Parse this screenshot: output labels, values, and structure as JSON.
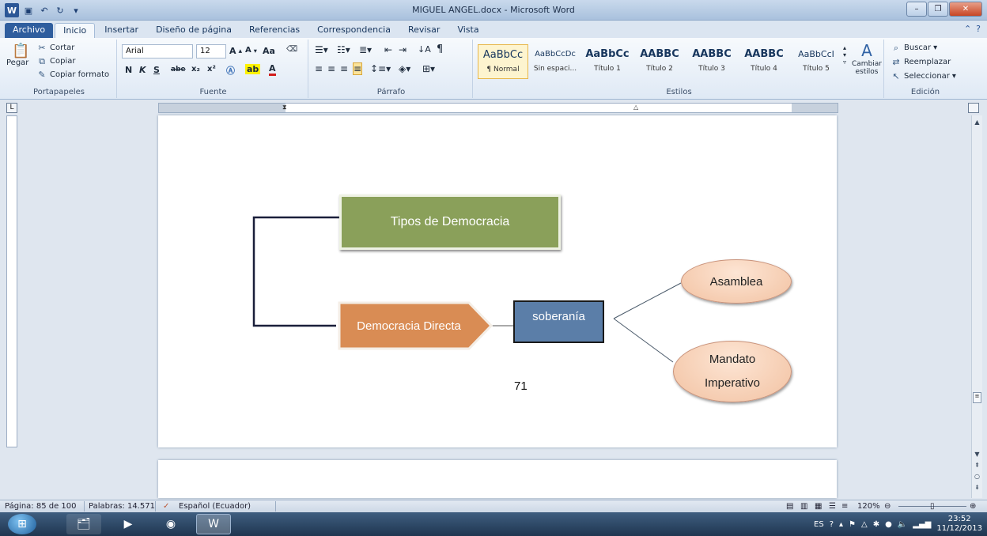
{
  "window": {
    "title": "MIGUEL ANGEL.docx - Microsoft Word",
    "app_logo": "W"
  },
  "tabs": [
    "Archivo",
    "Inicio",
    "Insertar",
    "Diseño de página",
    "Referencias",
    "Correspondencia",
    "Revisar",
    "Vista"
  ],
  "ribbon": {
    "clipboard": {
      "paste": "Pegar",
      "cut": "Cortar",
      "copy": "Copiar",
      "format_painter": "Copiar formato",
      "label": "Portapapeles"
    },
    "font": {
      "name": "Arial",
      "size": "12",
      "bold": "N",
      "italic": "K",
      "underline": "S",
      "strike": "abe",
      "sub": "x₂",
      "sup": "x²",
      "case": "Aa",
      "label": "Fuente"
    },
    "paragraph": {
      "label": "Párrafo"
    },
    "styles": {
      "label": "Estilos",
      "items": [
        {
          "preview": "AaBbCc",
          "name": "¶ Normal"
        },
        {
          "preview": "AaBbCcDc",
          "name": "Sin espaci..."
        },
        {
          "preview": "AaBbCc",
          "name": "Título 1"
        },
        {
          "preview": "AABBC",
          "name": "Título 2"
        },
        {
          "preview": "AABBC",
          "name": "Título 3"
        },
        {
          "preview": "AABBC",
          "name": "Título 4"
        },
        {
          "preview": "AaBbCcI",
          "name": "Título 5"
        }
      ],
      "change": "Cambiar estilos"
    },
    "editing": {
      "find": "Buscar",
      "replace": "Reemplazar",
      "select": "Seleccionar",
      "label": "Edición"
    }
  },
  "diagram": {
    "root": "Tipos de Democracia",
    "branch": "Democracia Directa",
    "concept": "soberanía",
    "leaf1": "Asamblea",
    "leaf2_line1": "Mandato",
    "leaf2_line2": "Imperativo",
    "page_number": "71"
  },
  "statusbar": {
    "page": "Página: 85 de 100",
    "words": "Palabras: 14.571",
    "language": "Español (Ecuador)",
    "zoom": "120%"
  },
  "taskbar": {
    "lang": "ES",
    "time": "23:52",
    "date": "11/12/2013"
  },
  "colors": {
    "root": "#8aa05a",
    "branch": "#d98c54",
    "concept": "#5b7ea8",
    "leaf": "#f2c2a2"
  }
}
